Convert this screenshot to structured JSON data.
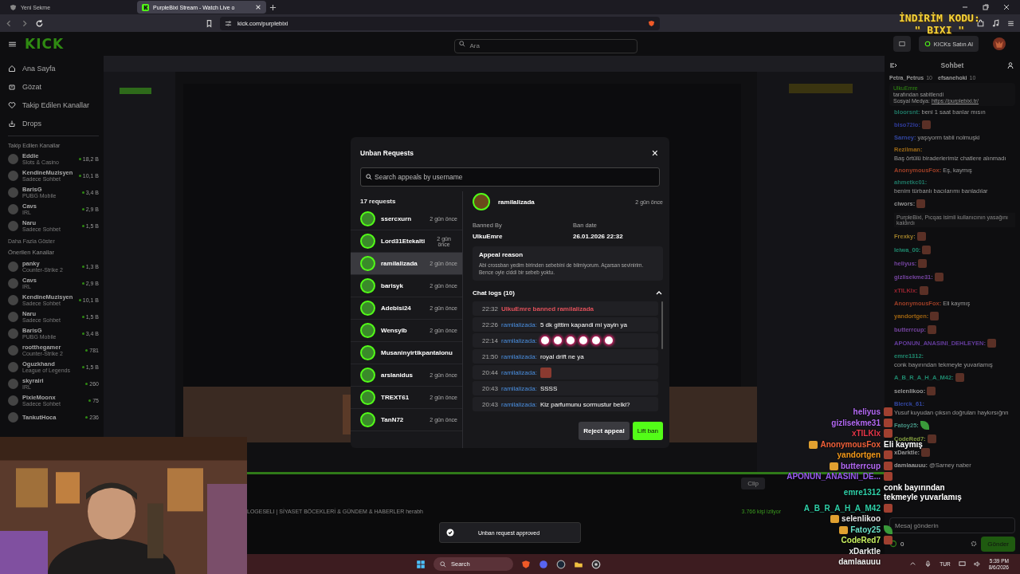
{
  "browser": {
    "tabs": [
      {
        "title": "Yeni Sekme",
        "selected": false
      },
      {
        "title": "PurpleBixi Stream - Watch Live o",
        "selected": true
      }
    ],
    "url": "kick.com/purplebixi"
  },
  "header": {
    "logo": "KICK",
    "search_placeholder": "Ara",
    "kicks_button": "KICKs Satın Al"
  },
  "sidebar": {
    "nav": [
      "Ana Sayfa",
      "Gözat",
      "Takip Edilen Kanallar",
      "Drops"
    ],
    "followed_title": "Takip Edilen Kanallar",
    "followed": [
      {
        "name": "Eddie",
        "category": "Slots & Casino",
        "viewers": "18,2 B"
      },
      {
        "name": "KendineMuzisyen",
        "category": "Sadece Sohbet",
        "viewers": "10,1 B"
      },
      {
        "name": "BarisG",
        "category": "PUBG Mobile",
        "viewers": "3,4 B"
      },
      {
        "name": "Cavs",
        "category": "IRL",
        "viewers": "2,9 B"
      },
      {
        "name": "Naru",
        "category": "Sadece Sohbet",
        "viewers": "1,5 B"
      }
    ],
    "show_more": "Daha Fazla Göster",
    "recommended_title": "Önerilen Kanallar",
    "recommended": [
      {
        "name": "panky",
        "category": "Counter-Strike 2",
        "viewers": "1,3 B"
      },
      {
        "name": "Cavs",
        "category": "IRL",
        "viewers": "2,9 B"
      },
      {
        "name": "KendineMuzisyen",
        "category": "Sadece Sohbet",
        "viewers": "10,1 B"
      },
      {
        "name": "Naru",
        "category": "Sadece Sohbet",
        "viewers": "1,5 B"
      },
      {
        "name": "BarisG",
        "category": "PUBG Mobile",
        "viewers": "3,4 B"
      },
      {
        "name": "rootthegamer",
        "category": "Counter-Strike 2",
        "viewers": "781"
      },
      {
        "name": "Oguzkhand",
        "category": "League of Legends",
        "viewers": "1,5 B"
      },
      {
        "name": "skyrairi",
        "category": "IRL",
        "viewers": "260"
      },
      {
        "name": "PixieMoonx",
        "category": "Sadece Sohbet",
        "viewers": "75"
      },
      {
        "name": "TankutHoca",
        "viewers": "236"
      }
    ]
  },
  "stream": {
    "kind": "picture",
    "clip": "Clip",
    "title": "LOGESELI | SİYASET BÖCEKLERİ & GÜNDEM & HABERLER herabh",
    "viewers": "3.766 kişi izliyor"
  },
  "chat": {
    "title": "Sohbet",
    "top": [
      {
        "name": "Petra_Petrus",
        "count": "10"
      },
      {
        "name": "efsanehoki",
        "count": "10"
      }
    ],
    "pinned": {
      "author": "UlkuEmre",
      "note": "tarafından sabitlendi",
      "label": "Sosyal Medya:",
      "link": "https://purplebixi.tr/"
    },
    "messages": [
      {
        "kind": "message",
        "user": "bloorsnt:",
        "color": "#1f7664",
        "text": "beni 1 saat banlar mısın"
      },
      {
        "kind": "message",
        "user": "biso72lo:",
        "color": "#303c9c",
        "emotes": [
          {
            "kind": "face"
          }
        ]
      },
      {
        "kind": "message",
        "user": "Sarney:",
        "color": "#3347a1",
        "text": "yaşıyorm tabii nolmuşki"
      },
      {
        "kind": "message",
        "user": "Rezilman:",
        "color": "#9c6815",
        "text": "Baş örtülü biraderlerimiz chatlere alınmadı"
      },
      {
        "kind": "message",
        "user": "AnonymousFox:",
        "color": "#9c3e26",
        "text": "Eş, kaymış"
      },
      {
        "kind": "message",
        "user": "ahmetkc01:",
        "color": "#1f7664",
        "text": "benim türbanlı bacılarımı banladılar"
      },
      {
        "kind": "message",
        "user": "ciwors:",
        "color": "#929292",
        "emotes": [
          {
            "kind": "face"
          }
        ]
      },
      {
        "kind": "system",
        "text": "PurpleBixi, Pıcqas isimli kullanıcının yasağını kaldırdı"
      },
      {
        "kind": "message",
        "user": "Frexky:",
        "color": "#9c7d2a",
        "emotes": [
          {
            "kind": "face"
          }
        ]
      },
      {
        "kind": "message",
        "user": "leiwa_00:",
        "color": "#1f876d",
        "emotes": [
          {
            "kind": "face"
          }
        ]
      },
      {
        "kind": "message",
        "user": "heliyus:",
        "color": "#75449f",
        "emotes": [
          {
            "kind": "face"
          }
        ]
      },
      {
        "kind": "message",
        "user": "gizlisekme31:",
        "color": "#75449f",
        "emotes": [
          {
            "kind": "face"
          }
        ]
      },
      {
        "kind": "message",
        "user": "xTILKIx:",
        "color": "#972430",
        "emotes": [
          {
            "kind": "face"
          }
        ]
      },
      {
        "kind": "message",
        "user": "AnonymousFox:",
        "color": "#9c3e26",
        "text": "Eli kaymış"
      },
      {
        "kind": "message",
        "user": "yandortgen:",
        "color": "#9f6411",
        "emotes": [
          {
            "kind": "face"
          }
        ]
      },
      {
        "kind": "message",
        "user": "butterrcup:",
        "color": "#75449f",
        "emotes": [
          {
            "kind": "face"
          }
        ]
      },
      {
        "kind": "message",
        "user": "APONUN_ANASINI_DEHLEYEN:",
        "color": "#643c9c",
        "emotes": [
          {
            "kind": "face"
          }
        ]
      },
      {
        "kind": "message",
        "user": "emre1312:",
        "color": "#1f876d",
        "text": "conk bayırından tekmeyle yuvarlamış"
      },
      {
        "kind": "message",
        "user": "A_B_R_A_H_A_M42:",
        "color": "#1f876d",
        "emotes": [
          {
            "kind": "face"
          }
        ]
      },
      {
        "kind": "message",
        "user": "selenlikoo:",
        "color": "#979797",
        "emotes": [
          {
            "kind": "face"
          }
        ]
      },
      {
        "kind": "message",
        "user": "Blerck_61:",
        "color": "#3347a1",
        "text": "Yusuf kuyudan çıksın doğruları haykırsığnn"
      },
      {
        "kind": "message",
        "user": "Fatoy25:",
        "color": "#459282",
        "emotes": [
          {
            "kind": "leaf"
          }
        ]
      },
      {
        "kind": "message",
        "user": "CodeRed7:",
        "color": "#829c3e",
        "emotes": [
          {
            "kind": "face"
          }
        ]
      },
      {
        "kind": "message",
        "user": "xDarktle:",
        "color": "#979797",
        "emotes": [
          {
            "kind": "face"
          }
        ]
      },
      {
        "kind": "message",
        "user": "damlaauuu:",
        "color": "#979797",
        "text": "@Sarney naber"
      }
    ],
    "input_placeholder": "Mesaj gönderin",
    "points": "0",
    "send": "Gönder"
  },
  "modal": {
    "title": "Unban Requests",
    "close": "×",
    "search_placeholder": "Search appeals by username",
    "count": "17 requests",
    "requests": [
      {
        "name": "ssercxurn",
        "time": "2 gün önce",
        "selected": false
      },
      {
        "name": "Lord31Etekalti",
        "time": "2 gün önce",
        "selected": false
      },
      {
        "name": "ramilalizada",
        "time": "2 gün önce",
        "selected": true
      },
      {
        "name": "barisyk",
        "time": "2 gün önce",
        "selected": false
      },
      {
        "name": "Adebisi24",
        "time": "2 gün önce",
        "selected": false
      },
      {
        "name": "Wensylb",
        "time": "2 gün önce",
        "selected": false
      },
      {
        "name": "Musaninyirtikpantalonu",
        "selected": false
      },
      {
        "name": "arslanidus",
        "time": "2 gün önce",
        "selected": false
      },
      {
        "name": "TREXT61",
        "time": "2 gün önce",
        "selected": false
      },
      {
        "name": "TanN72",
        "time": "2 gün önce",
        "selected": false
      }
    ],
    "detail": {
      "user": "ramilalizada",
      "time": "2 gün önce",
      "banned_by_label": "Banned By",
      "banned_by": "UlkuEmre",
      "ban_date_label": "Ban date",
      "ban_date": "26.01.2026 22:32",
      "appeal_label": "Appeal reason",
      "appeal_text": "Abi crossban yedim birinden sebebini de bilmiyorum. Açarsan sevinirim. Bence oyle ciddi bir sebeb yoktu.",
      "logs_label": "Chat logs (10)",
      "logs_expanded": true,
      "logs": [
        {
          "kind": "ban",
          "time": "22:32",
          "text": "UlkuEmre banned ramilalizada"
        },
        {
          "kind": "message",
          "time": "22:26",
          "user": "ramilalizada:",
          "text": "5 dk gittim kapandi mi yayin ya"
        },
        {
          "kind": "message",
          "time": "22:14",
          "user": "ramilalizada:",
          "emotes": [
            {
              "kind": "circle"
            },
            {
              "kind": "circle"
            },
            {
              "kind": "circle"
            },
            {
              "kind": "circle"
            },
            {
              "kind": "circle"
            },
            {
              "kind": "circle"
            }
          ]
        },
        {
          "kind": "message",
          "time": "21:50",
          "user": "ramilalizada:",
          "text": "royal drift ne ya"
        },
        {
          "kind": "message",
          "time": "20:44",
          "user": "ramilalizada:",
          "emotes": [
            {
              "kind": "face"
            }
          ]
        },
        {
          "kind": "message",
          "time": "20:43",
          "user": "ramilalizada:",
          "text": "SSSS"
        },
        {
          "kind": "message",
          "time": "20:43",
          "user": "ramilalizada:",
          "text": "Kiz parfumunu sormustur belki?"
        }
      ]
    },
    "reject": "Reject appeal",
    "lift": "Lift ban"
  },
  "toast": "Unban request approved",
  "promo": [
    "İNDİRİM KODU:",
    "\" BIXI \""
  ],
  "overlay_chat": [
    {
      "user": "heliyus",
      "color": "#b469f5",
      "emotes": [
        {
          "kind": "face"
        }
      ]
    },
    {
      "user": "gizlisekme31",
      "color": "#b469f5",
      "emotes": [
        {
          "kind": "face"
        }
      ]
    },
    {
      "user": "xTILKIx",
      "color": "#e8374a",
      "emotes": [
        {
          "kind": "face"
        }
      ]
    },
    {
      "user": "AnonymousFox",
      "color": "#f0603a",
      "badges": [
        {
          "kind": "crown"
        }
      ],
      "text": "Eli kaymış"
    },
    {
      "user": "yandortgen",
      "color": "#f59a1a",
      "emotes": [
        {
          "kind": "face"
        }
      ]
    },
    {
      "user": "butterrcup",
      "color": "#b469f5",
      "badges": [
        {
          "kind": "crown"
        }
      ],
      "emotes": [
        {
          "kind": "face"
        }
      ]
    },
    {
      "user": "APONUN_ANASINI_DE...",
      "color": "#9a5cf0",
      "emotes": [
        {
          "kind": "face"
        }
      ]
    },
    {
      "user": "emre1312",
      "color": "#2fd0a8",
      "text": "conk bayırından tekmeyle yuvarlamış"
    },
    {
      "user": "A_B_R_A_H_A_M42",
      "color": "#2fd0a8",
      "emotes": [
        {
          "kind": "face"
        }
      ]
    },
    {
      "user": "selenlikoo",
      "color": "#e8e8e8",
      "badges": [
        {
          "kind": "crown"
        }
      ]
    },
    {
      "user": "Fatoy25",
      "color": "#6ae0c8",
      "badges": [
        {
          "kind": "crown"
        }
      ],
      "emotes": [
        {
          "kind": "leaf"
        }
      ]
    },
    {
      "user": "CodeRed7",
      "color": "#c8f060",
      "emotes": [
        {
          "kind": "face"
        }
      ]
    },
    {
      "user": "xDarktle",
      "color": "#f0f0f0"
    },
    {
      "user": "damlaauuu",
      "color": "#f0f0f0"
    }
  ],
  "taskbar": {
    "search": "Search",
    "lang": "TUR",
    "time": "5:39 PM",
    "date": "8/6/2026"
  }
}
